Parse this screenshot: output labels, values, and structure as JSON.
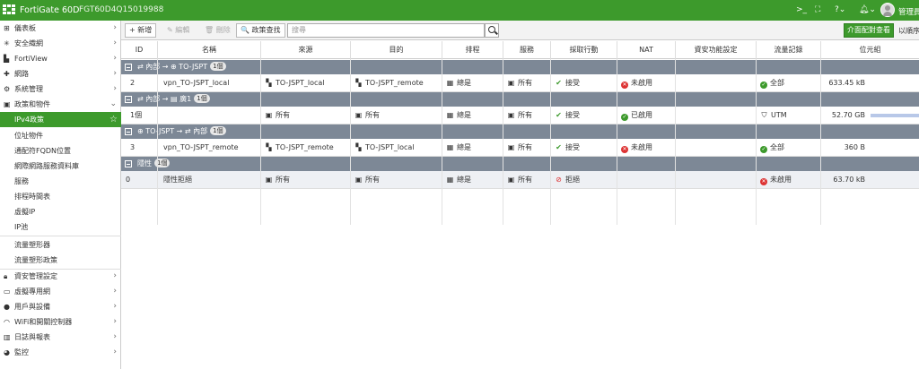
{
  "topbar": {
    "brand": "FortiGate 60D",
    "serial": "FGT60D4Q15019988",
    "icons": [
      "terminal-icon",
      "fullscreen-icon",
      "help-icon",
      "bell-icon"
    ],
    "user_label": "管理員"
  },
  "sidebar": {
    "items": [
      {
        "label": "儀表板",
        "icon": "dashboard-icon"
      },
      {
        "label": "安全織網",
        "icon": "fabric-icon"
      },
      {
        "label": "FortiView",
        "icon": "fortiview-icon"
      },
      {
        "label": "網路",
        "icon": "network-icon"
      },
      {
        "label": "系統管理",
        "icon": "system-icon"
      },
      {
        "label": "政策和物件",
        "icon": "policy-icon"
      }
    ],
    "subitems": [
      "IPv4政策",
      "位址物件",
      "通配符FQDN位置",
      "網際網路服務資料庫",
      "服務",
      "排程時間表",
      "虛擬IP",
      "IP池",
      "流量塑形器",
      "流量塑形政策"
    ],
    "items_bottom": [
      {
        "label": "資安管理設定",
        "icon": "lock-icon"
      },
      {
        "label": "虛擬專用網",
        "icon": "monitor-icon"
      },
      {
        "label": "用戶與設備",
        "icon": "user-icon"
      },
      {
        "label": "WiFi和開關控制器",
        "icon": "wifi-icon"
      },
      {
        "label": "日誌與報表",
        "icon": "chart-icon"
      },
      {
        "label": "監控",
        "icon": "monitor-icon"
      }
    ]
  },
  "toolbar": {
    "new_label": "+ 新增",
    "edit_label": "✎ 編輯",
    "delete_label": "🗑 刪除",
    "policy_lookup_label": "🔍 政策查找",
    "search_placeholder": "搜尋",
    "interface_pair_label": "介面配對查看",
    "by_sequence_label": "以順序"
  },
  "table": {
    "columns": [
      "ID",
      "名稱",
      "來源",
      "目的",
      "排程",
      "服務",
      "採取行動",
      "NAT",
      "資安功能設定",
      "流量記錄",
      "位元組"
    ],
    "groups": [
      {
        "label": "⇄ 內部 → ⊕ TO-JSPT",
        "count": "1個",
        "rows": [
          {
            "id": "2",
            "name": "vpn_TO-JSPT_local",
            "src": "TO-JSPT_local",
            "dst": "TO-JSPT_remote",
            "schedule": "總是",
            "service": "所有",
            "action": "接受",
            "nat": "未啟用",
            "security": "",
            "log": "全部",
            "bytes": "633.45 kB"
          }
        ]
      },
      {
        "label": "⇄ 內部 → ▤ 廣1",
        "count": "1個",
        "rows": [
          {
            "id": "1個",
            "name": "",
            "src": "所有",
            "dst": "所有",
            "schedule": "總是",
            "service": "所有",
            "action": "接受",
            "nat": "已啟用",
            "security": "",
            "log": "UTM",
            "bytes": "52.70 GB"
          }
        ]
      },
      {
        "label": "⊕ TO-JSPT → ⇄ 內部",
        "count": "1個",
        "rows": [
          {
            "id": "3",
            "name": "vpn_TO-JSPT_remote",
            "src": "TO-JSPT_remote",
            "dst": "TO-JSPT_local",
            "schedule": "總是",
            "service": "所有",
            "action": "接受",
            "nat": "未啟用",
            "security": "",
            "log": "全部",
            "bytes": "360 B"
          }
        ]
      },
      {
        "label": "隱性",
        "count": "1個",
        "rows": [
          {
            "id": "0",
            "name": "隱性拒絕",
            "src": "所有",
            "dst": "所有",
            "schedule": "總是",
            "service": "所有",
            "action": "拒絕",
            "nat": "",
            "security": "",
            "log": "未啟用",
            "bytes": "63.70 kB"
          }
        ]
      }
    ]
  },
  "colors": {
    "accent": "#3d9a2c",
    "group_header": "#7d8896"
  }
}
